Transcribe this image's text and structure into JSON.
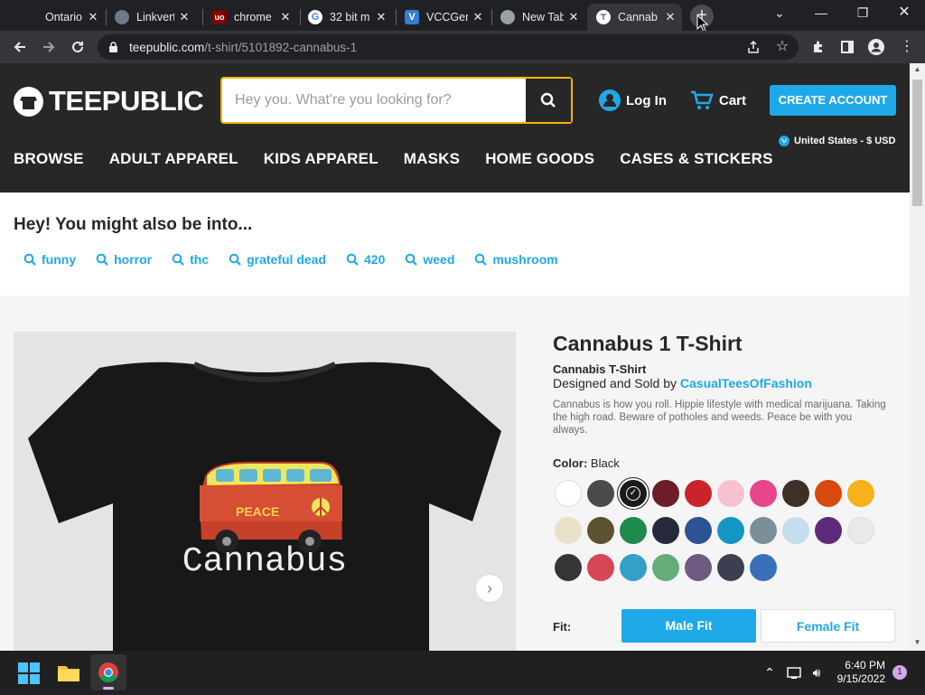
{
  "browser": {
    "tabs": [
      {
        "title": "Ontario",
        "favicon": "ontario-icon",
        "fav_color": "#202124"
      },
      {
        "title": "Linkvert",
        "favicon": "avatar-favicon",
        "fav_color": "#6c7a8b"
      },
      {
        "title": "chrome",
        "favicon": "ublock-icon",
        "fav_color": "#800000"
      },
      {
        "title": "32 bit m",
        "favicon": "google-icon",
        "fav_color": "#ffffff"
      },
      {
        "title": "VCCGen",
        "favicon": "v-icon",
        "fav_color": "#3a7bd5"
      },
      {
        "title": "New Tab",
        "favicon": "chrome-icon",
        "fav_color": "#9aa0a6"
      },
      {
        "title": "Cannab",
        "favicon": "teepublic-favicon",
        "fav_color": "#ffffff"
      }
    ],
    "active_tab": 6,
    "url_host": "teepublic.com",
    "url_path": "/t-shirt/5101892-cannabus-1"
  },
  "header": {
    "logo": "TEEPUBLIC",
    "search_placeholder": "Hey you. What're you looking for?",
    "login": "Log In",
    "cart": "Cart",
    "create_account": "CREATE ACCOUNT",
    "locale": "United States - $ USD",
    "nav": [
      "BROWSE",
      "ADULT APPAREL",
      "KIDS APPAREL",
      "MASKS",
      "HOME GOODS",
      "CASES & STICKERS"
    ]
  },
  "also": {
    "heading": "Hey! You might also be into...",
    "chips": [
      "funny",
      "horror",
      "thc",
      "grateful dead",
      "420",
      "weed",
      "mushroom"
    ]
  },
  "product": {
    "title": "Cannabus 1 T-Shirt",
    "subtitle": "Cannabis T-Shirt",
    "by_prefix": "Designed and Sold by",
    "designer": "CasualTeesOfFashion",
    "description": "Cannabus is how you roll. Hippie lifestyle with medical marijuana. Taking the high road. Beware of potholes and weeds. Peace be with you always.",
    "color_label": "Color:",
    "color_value": "Black",
    "swatches": [
      "#ffffff",
      "#4a4a4a",
      "#1a1a1a",
      "#6b1e27",
      "#c9232b",
      "#f8c1cf",
      "#e8458b",
      "#3e2f27",
      "#d9490d",
      "#f6b11b",
      "#e9e0c8",
      "#5d5230",
      "#1e8a4c",
      "#25293a",
      "#2e5394",
      "#1595c5",
      "#7b8f9a",
      "#c5dded",
      "#5d2b7a",
      "#e9e9e9",
      "#353535",
      "#d84555",
      "#33a0c9",
      "#64ad78",
      "#6d5a80",
      "#3b4050",
      "#3a70b8"
    ],
    "selected_swatch": 2,
    "shirt_text": "Cannabus",
    "bus_text": "PEACE",
    "fit_label": "Fit:",
    "fit_options": [
      "Male Fit",
      "Female Fit"
    ],
    "selected_fit": 0
  },
  "taskbar": {
    "time": "6:40 PM",
    "date": "9/15/2022",
    "notifications": "1"
  },
  "colors": {
    "accent": "#1fa8e8",
    "header_bg": "#272727",
    "search_border": "#f7b500"
  }
}
